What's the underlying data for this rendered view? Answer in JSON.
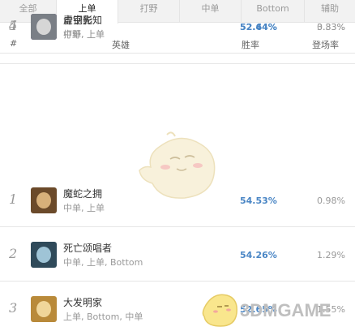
{
  "tabs": [
    {
      "label": "全部"
    },
    {
      "label": "上单",
      "active": true
    },
    {
      "label": "打野"
    },
    {
      "label": "中单"
    },
    {
      "label": "Bottom"
    },
    {
      "label": "辅助"
    }
  ],
  "table": {
    "headers": {
      "index": "#",
      "hero": "英雄",
      "win_rate": "胜率",
      "pick_rate": "登场率"
    },
    "rows": [
      {
        "rank": "1",
        "name": "魔蛇之拥",
        "roles": "中单, 上单",
        "win_rate": "54.53%",
        "pick_rate": "0.98%",
        "avatar_icon": "cassiopeia-portrait",
        "avatar_color": "#6b4a2a"
      },
      {
        "rank": "2",
        "name": "死亡颂唱者",
        "roles": "中单, 上单, Bottom",
        "win_rate": "54.26%",
        "pick_rate": "1.29%",
        "avatar_icon": "karthus-portrait",
        "avatar_color": "#2f4a5a"
      },
      {
        "rank": "3",
        "name": "大发明家",
        "roles": "上单, Bottom, 中单",
        "win_rate": "52.65%",
        "pick_rate": "1.55%",
        "avatar_icon": "heimerdinger-portrait",
        "avatar_color": "#b98a3a"
      },
      {
        "rank": "4",
        "name": "虚空先知",
        "roles": "中单, 上单",
        "win_rate": "52.64%",
        "pick_rate": "0.83%",
        "avatar_icon": "malzahar-portrait",
        "avatar_color": "#4a2a6a"
      },
      {
        "rank": "5",
        "name": "青钢影",
        "roles": "打野, 上单",
        "win_rate": "52.44%",
        "pick_rate": "3.33%",
        "avatar_icon": "camille-portrait",
        "avatar_color": "#7a7f86"
      }
    ]
  },
  "watermark": {
    "text": "3DMGAME"
  },
  "colors": {
    "accent": "#4a86c5",
    "muted": "#999999"
  }
}
